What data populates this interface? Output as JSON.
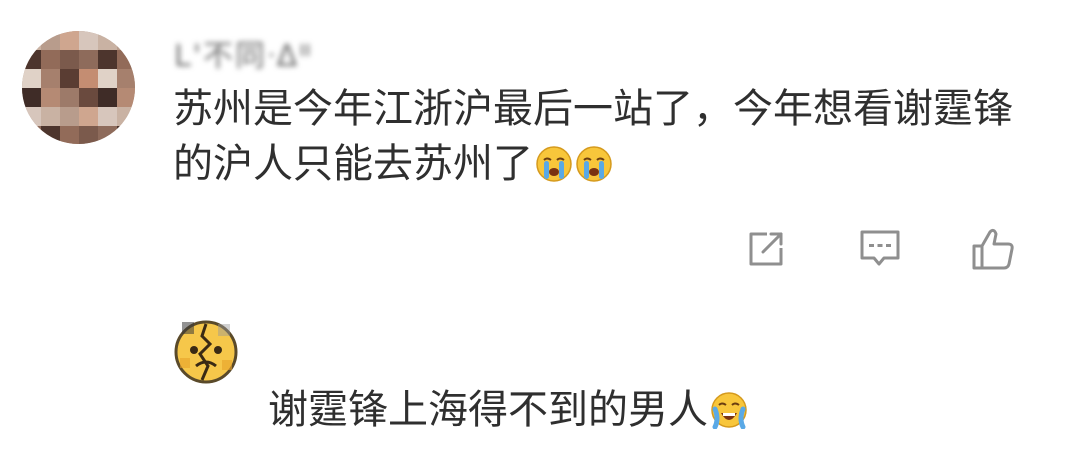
{
  "comment": {
    "avatar_icon": "pixelated-avatar",
    "username": "ᒪ'不同ᐧᐃᐦ",
    "text": "苏州是今年江浙沪最后一站了，今年想看谢霆锋的沪人只能去苏州了",
    "emojis": [
      "crying-face-icon",
      "crying-face-icon"
    ],
    "actions": {
      "share_icon": "share-icon",
      "comment_icon": "comment-icon",
      "like_icon": "thumbs-up-icon"
    }
  },
  "reply": {
    "avatar_icon": "cracked-emoji-avatar",
    "text": "谢霆锋上海得不到的男人",
    "emoji": "loudly-crying-face-icon"
  },
  "colors": {
    "text": "#2f2f2f",
    "icon": "#8f8f8f",
    "emoji_yellow": "#f8c63b",
    "tear_blue": "#5aa9e6"
  }
}
